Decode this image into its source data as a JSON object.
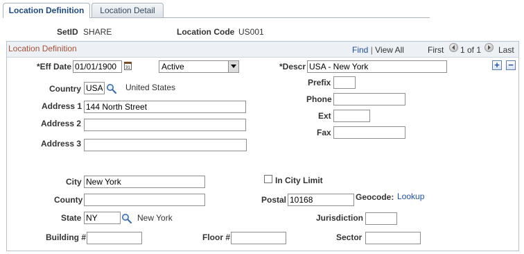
{
  "tabs": [
    {
      "label": "Location Definition",
      "active": true
    },
    {
      "label": "Location Detail",
      "active": false
    }
  ],
  "header": {
    "setid_label": "SetID",
    "setid_value": "SHARE",
    "location_code_label": "Location Code",
    "location_code_value": "US001"
  },
  "panel": {
    "title": "Location Definition",
    "find_link": "Find",
    "separator": "|",
    "view_all_link": "View All",
    "first_label": "First",
    "pager_text": "1 of 1",
    "last_label": "Last"
  },
  "form": {
    "eff_date_label": "*Eff Date",
    "eff_date_value": "01/01/1900",
    "status_value": "Active",
    "descr_label": "*Descr",
    "descr_value": "USA - New York",
    "country_label": "Country",
    "country_value": "USA",
    "country_name": "United States",
    "address1_label": "Address 1",
    "address1_value": "144 North Street",
    "address2_label": "Address 2",
    "address2_value": "",
    "address3_label": "Address 3",
    "address3_value": "",
    "prefix_label": "Prefix",
    "prefix_value": "",
    "phone_label": "Phone",
    "phone_value": "",
    "ext_label": "Ext",
    "ext_value": "",
    "fax_label": "Fax",
    "fax_value": "",
    "city_label": "City",
    "city_value": "New York",
    "in_city_limit_label": "In City Limit",
    "county_label": "County",
    "county_value": "",
    "postal_label": "Postal",
    "postal_value": "10168",
    "geocode_label": "Geocode:",
    "geocode_link": "Lookup",
    "state_label": "State",
    "state_value": "NY",
    "state_name": "New York",
    "jurisdiction_label": "Jurisdiction",
    "jurisdiction_value": "",
    "building_label": "Building #",
    "building_value": "",
    "floor_label": "Floor #",
    "floor_value": "",
    "sector_label": "Sector",
    "sector_value": ""
  },
  "icons": {
    "calendar": "calendar-icon",
    "lookup": "magnifier-icon",
    "add_row": "plus-icon",
    "delete_row": "minus-icon",
    "prev": "arrow-left-icon",
    "next": "arrow-right-icon"
  }
}
